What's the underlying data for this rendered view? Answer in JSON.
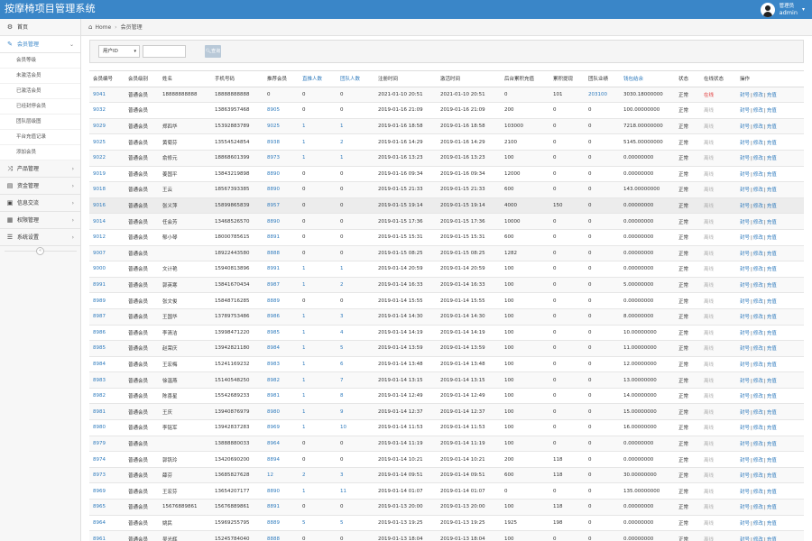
{
  "app": {
    "title": "按摩椅项目管理系统"
  },
  "user": {
    "role": "管理员",
    "name": "admin"
  },
  "sidebar": {
    "items": [
      {
        "icon": "dashboard-icon",
        "label": "首页"
      },
      {
        "icon": "member-icon",
        "label": "会员管理"
      },
      {
        "icon": "product-icon",
        "label": "产品管理"
      },
      {
        "icon": "funds-icon",
        "label": "资金管理"
      },
      {
        "icon": "message-icon",
        "label": "信息交流"
      },
      {
        "icon": "permission-icon",
        "label": "权限管理"
      },
      {
        "icon": "settings-icon",
        "label": "系统设置"
      }
    ],
    "member_sub": [
      "会员等级",
      "未激活会员",
      "已激活会员",
      "已经封停会员",
      "团队层级图",
      "平台充值记录",
      "添加会员"
    ]
  },
  "breadcrumb": {
    "home": "Home",
    "current": "会员管理"
  },
  "filter": {
    "select_value": "用户ID",
    "search_label": "查询"
  },
  "table": {
    "headers": [
      "会员编号",
      "会员级别",
      "姓名",
      "手机号码",
      "推荐会员",
      "直推人数",
      "团队人数",
      "注册时间",
      "激活时间",
      "后台累积充值",
      "累积提现",
      "团队业绩",
      "钱包结余",
      "状态",
      "在线状态",
      "操作"
    ],
    "actions": {
      "freeze": "封号",
      "edit": "修改",
      "recharge": "充值"
    },
    "rows": [
      [
        "9041",
        "普通会员",
        "18888888888",
        "18888888888",
        "0",
        "0",
        "0",
        "2021-01-10 20:51",
        "2021-01-10 20:51",
        "0",
        "101",
        "203100",
        "3030.18000000",
        "正常",
        "在线"
      ],
      [
        "9032",
        "普通会员",
        "",
        "13863957468",
        "8905",
        "0",
        "0",
        "2019-01-16 21:09",
        "2019-01-16 21:09",
        "200",
        "0",
        "0",
        "100.00000000",
        "正常",
        "离线"
      ],
      [
        "9029",
        "普通会员",
        "郑四华",
        "15392883789",
        "9025",
        "1",
        "1",
        "2019-01-16 18:58",
        "2019-01-16 18:58",
        "103000",
        "0",
        "0",
        "7218.00000000",
        "正常",
        "离线"
      ],
      [
        "9025",
        "普通会员",
        "黄菊芬",
        "13554524854",
        "8938",
        "1",
        "2",
        "2019-01-16 14:29",
        "2019-01-16 14:29",
        "2100",
        "0",
        "0",
        "5145.00000000",
        "正常",
        "离线"
      ],
      [
        "9022",
        "普通会员",
        "俞修元",
        "18868601399",
        "8973",
        "1",
        "1",
        "2019-01-16 13:23",
        "2019-01-16 13:23",
        "100",
        "0",
        "0",
        "0.00000000",
        "正常",
        "离线"
      ],
      [
        "9019",
        "普通会员",
        "姜国平",
        "13843219898",
        "8890",
        "0",
        "0",
        "2019-01-16 09:34",
        "2019-01-16 09:34",
        "12000",
        "0",
        "0",
        "0.00000000",
        "正常",
        "离线"
      ],
      [
        "9018",
        "普通会员",
        "王云",
        "18567393385",
        "8890",
        "0",
        "0",
        "2019-01-15 21:33",
        "2019-01-15 21:33",
        "600",
        "0",
        "0",
        "143.00000000",
        "正常",
        "离线"
      ],
      [
        "9016",
        "普通会员",
        "张义萍",
        "15899865839",
        "8957",
        "0",
        "0",
        "2019-01-15 19:14",
        "2019-01-15 19:14",
        "4000",
        "150",
        "0",
        "0.00000000",
        "正常",
        "离线"
      ],
      [
        "9014",
        "普通会员",
        "任会芳",
        "13468526570",
        "8890",
        "0",
        "0",
        "2019-01-15 17:36",
        "2019-01-15 17:36",
        "10000",
        "0",
        "0",
        "0.00000000",
        "正常",
        "离线"
      ],
      [
        "9012",
        "普通会员",
        "郁小琴",
        "18000785615",
        "8891",
        "0",
        "0",
        "2019-01-15 15:31",
        "2019-01-15 15:31",
        "600",
        "0",
        "0",
        "0.00000000",
        "正常",
        "离线"
      ],
      [
        "9007",
        "普通会员",
        "",
        "18922443580",
        "8888",
        "0",
        "0",
        "2019-01-15 08:25",
        "2019-01-15 08:25",
        "1282",
        "0",
        "0",
        "0.00000000",
        "正常",
        "离线"
      ],
      [
        "9000",
        "普通会员",
        "文计艳",
        "15940813896",
        "8991",
        "1",
        "1",
        "2019-01-14 20:59",
        "2019-01-14 20:59",
        "100",
        "0",
        "0",
        "0.00000000",
        "正常",
        "离线"
      ],
      [
        "8991",
        "普通会员",
        "郭英寒",
        "13841670434",
        "8987",
        "1",
        "2",
        "2019-01-14 16:33",
        "2019-01-14 16:33",
        "100",
        "0",
        "0",
        "5.00000000",
        "正常",
        "离线"
      ],
      [
        "8989",
        "普通会员",
        "张文俊",
        "15848716285",
        "8889",
        "0",
        "0",
        "2019-01-14 15:55",
        "2019-01-14 15:55",
        "100",
        "0",
        "0",
        "0.00000000",
        "正常",
        "离线"
      ],
      [
        "8987",
        "普通会员",
        "王国华",
        "13789753486",
        "8986",
        "1",
        "3",
        "2019-01-14 14:30",
        "2019-01-14 14:30",
        "100",
        "0",
        "0",
        "8.00000000",
        "正常",
        "离线"
      ],
      [
        "8986",
        "普通会员",
        "李清洁",
        "13998471220",
        "8985",
        "1",
        "4",
        "2019-01-14 14:19",
        "2019-01-14 14:19",
        "100",
        "0",
        "0",
        "10.00000000",
        "正常",
        "离线"
      ],
      [
        "8985",
        "普通会员",
        "赵荣庆",
        "13942821180",
        "8984",
        "1",
        "5",
        "2019-01-14 13:59",
        "2019-01-14 13:59",
        "100",
        "0",
        "0",
        "11.00000000",
        "正常",
        "离线"
      ],
      [
        "8984",
        "普通会员",
        "王宏梅",
        "15241169232",
        "8983",
        "1",
        "6",
        "2019-01-14 13:48",
        "2019-01-14 13:48",
        "100",
        "0",
        "0",
        "12.00000000",
        "正常",
        "离线"
      ],
      [
        "8983",
        "普通会员",
        "徐温燕",
        "15140548250",
        "8982",
        "1",
        "7",
        "2019-01-14 13:15",
        "2019-01-14 13:15",
        "100",
        "0",
        "0",
        "13.00000000",
        "正常",
        "离线"
      ],
      [
        "8982",
        "普通会员",
        "陈喜星",
        "15542689233",
        "8981",
        "1",
        "8",
        "2019-01-14 12:49",
        "2019-01-14 12:49",
        "100",
        "0",
        "0",
        "14.00000000",
        "正常",
        "离线"
      ],
      [
        "8981",
        "普通会员",
        "王庆",
        "13940876979",
        "8980",
        "1",
        "9",
        "2019-01-14 12:37",
        "2019-01-14 12:37",
        "100",
        "0",
        "0",
        "15.00000000",
        "正常",
        "离线"
      ],
      [
        "8980",
        "普通会员",
        "李铭军",
        "13942837283",
        "8969",
        "1",
        "10",
        "2019-01-14 11:53",
        "2019-01-14 11:53",
        "100",
        "0",
        "0",
        "16.00000000",
        "正常",
        "离线"
      ],
      [
        "8979",
        "普通会员",
        "",
        "13888880033",
        "8964",
        "0",
        "0",
        "2019-01-14 11:19",
        "2019-01-14 11:19",
        "100",
        "0",
        "0",
        "0.00000000",
        "正常",
        "离线"
      ],
      [
        "8974",
        "普通会员",
        "郭钒玲",
        "13420690200",
        "8894",
        "0",
        "0",
        "2019-01-14 10:21",
        "2019-01-14 10:21",
        "200",
        "118",
        "0",
        "0.00000000",
        "正常",
        "离线"
      ],
      [
        "8973",
        "普通会员",
        "薛芬",
        "13685827628",
        "12",
        "2",
        "3",
        "2019-01-14 09:51",
        "2019-01-14 09:51",
        "600",
        "118",
        "0",
        "30.00000000",
        "正常",
        "离线"
      ],
      [
        "8969",
        "普通会员",
        "王宏芬",
        "13654207177",
        "8890",
        "1",
        "11",
        "2019-01-14 01:07",
        "2019-01-14 01:07",
        "0",
        "0",
        "0",
        "135.00000000",
        "正常",
        "离线"
      ],
      [
        "8965",
        "普通会员",
        "15676889861",
        "15676889861",
        "8891",
        "0",
        "0",
        "2019-01-13 20:00",
        "2019-01-13 20:00",
        "100",
        "118",
        "0",
        "0.00000000",
        "正常",
        "离线"
      ],
      [
        "8964",
        "普通会员",
        "姚民",
        "15969255795",
        "8889",
        "5",
        "5",
        "2019-01-13 19:25",
        "2019-01-13 19:25",
        "1925",
        "198",
        "0",
        "0.00000000",
        "正常",
        "离线"
      ],
      [
        "8961",
        "普通会员",
        "吴光辉",
        "15245784040",
        "8888",
        "0",
        "0",
        "2019-01-13 18:04",
        "2019-01-13 18:04",
        "100",
        "0",
        "0",
        "0.00000000",
        "正常",
        "离线"
      ]
    ]
  }
}
